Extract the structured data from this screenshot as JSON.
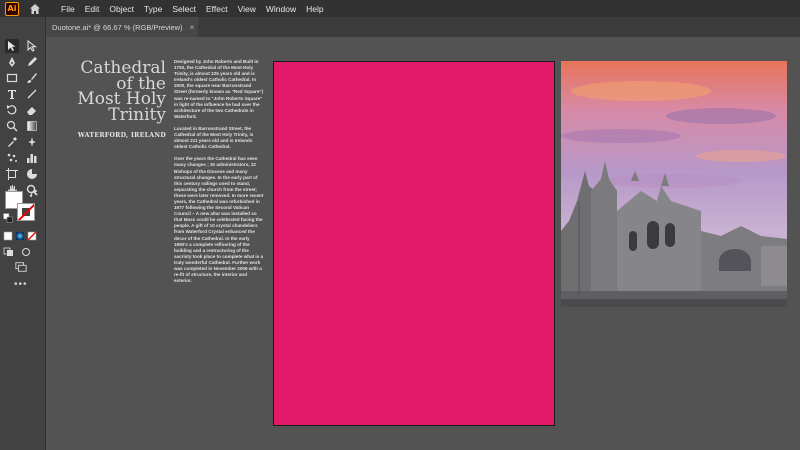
{
  "app": {
    "logo_text": "Ai",
    "menu": [
      "File",
      "Edit",
      "Object",
      "Type",
      "Select",
      "Effect",
      "View",
      "Window",
      "Help"
    ]
  },
  "document_tab": {
    "title": "Duotone.ai* @ 66.67 % (RGB/Preview)",
    "close": "×"
  },
  "toolbar": {
    "tools": [
      "selection-tool",
      "direct-selection-tool",
      "pen-tool",
      "pencil-tool",
      "rectangle-tool",
      "paintbrush-tool",
      "type-tool",
      "line-segment-tool",
      "rotate-tool",
      "eraser-tool",
      "scale-tool",
      "gradient-tool",
      "eyedropper-tool",
      "blend-tool",
      "symbol-sprayer-tool",
      "column-graph-tool",
      "artboard-tool",
      "slice-tool",
      "hand-tool",
      "zoom-tool"
    ],
    "more": "•••"
  },
  "artboard": {
    "title_lines": [
      "Cathedral",
      "of the",
      "Most Holy",
      "Trinity"
    ],
    "subtitle": "WATERFORD, IRELAND",
    "paragraphs": [
      "Designed by John Roberts and Built in 1793, the Cathedral of the Most Holy Trinity, is almost 225 years old and is Ireland's oldest Catholic Cathedral. In 2000, the square near Barronstrand Street (formerly known as \"Red Square\") was re-named to \"John Roberts Square\" in light of the influence he had over the architecture of the two Cathedrals in Waterford.",
      "Located in Barronstrand Street, the Cathedral of the Most Holy Trinity, is almost 211 years old and is Irelands oldest Catholic Cathedral.",
      "Over the years the Cathedral has seen many changes ; 30 administrators, 22 Bishops of the Diocese and many structural changes. In the early part of this century railings used to stand, separating the church from the street; these were later removed. In more recent years, the Cathedral was refurbished in 1977 following the Second Vatican Council – A new altar was installed so that Mass could be celebrated facing the people. A gift of 10 crystal chandeliers from Waterford Crystal enhanced the decor of the Cathedral. In the early 1990's a complete reflooring of the building and a restructuring of the sacristy took place to complete what is a truly wonderful Cathedral. Further work was completed in November 2006 with a re-fit of structure, the interior and exterior."
    ]
  },
  "colors": {
    "pink": "#e31a6a",
    "workspace": "#535353",
    "menubar": "#323232"
  }
}
